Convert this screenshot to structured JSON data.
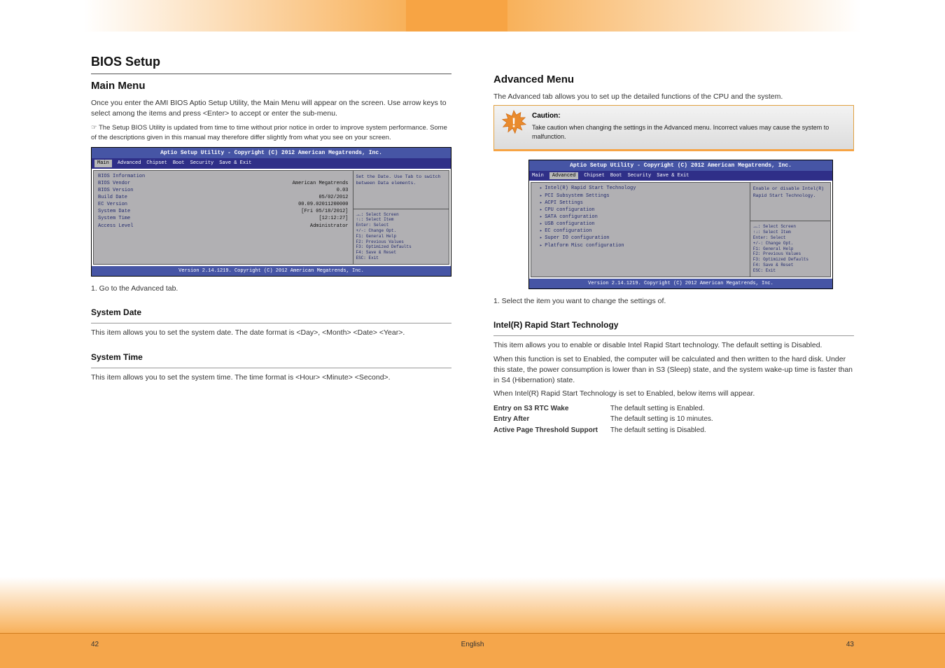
{
  "top_tab": {
    "left": "",
    "center": "",
    "right": ""
  },
  "left_col": {
    "main_heading": "BIOS Setup",
    "section_heading": "Main Menu",
    "intro1": "Once you enter the AMI BIOS Aptio Setup Utility, the Main Menu will appear on the screen. Use arrow keys to select among the items and press <Enter> to accept or enter the sub-menu.",
    "note1": "☞ The Setup BIOS Utility is updated from time to time without prior notice in order to improve system performance. Some of the descriptions given in this manual may therefore differ slightly from what you see on your screen.",
    "bios1": {
      "title": "Aptio Setup Utility - Copyright (C) 2012 American Megatrends, Inc.",
      "tabs": [
        "Main",
        "Advanced",
        "Chipset",
        "Boot",
        "Security",
        "Save & Exit"
      ],
      "active_tab": 0,
      "rows": [
        [
          "BIOS Information",
          ""
        ],
        [
          "BIOS Vendor",
          "American Megatrends"
        ],
        [
          "BIOS Version",
          "0.03"
        ],
        [
          "Build Date",
          "05/02/2012"
        ],
        [
          "",
          ""
        ],
        [
          "EC Version",
          "00.09.02011200000"
        ],
        [
          "",
          ""
        ],
        [
          "System Date",
          "[Fri 05/18/2012]"
        ],
        [
          "System Time",
          "[12:12:27]"
        ],
        [
          "",
          ""
        ],
        [
          "Access Level",
          "Administrator"
        ]
      ],
      "help": "Set the Date. Use Tab to switch between Data elements.",
      "nav": [
        "→←: Select Screen",
        "↑↓: Select Item",
        "Enter: Select",
        "+/-: Change Opt.",
        "F1: General Help",
        "F2: Previous Values",
        "F3: Optimized Defaults",
        "F4: Save & Reset",
        "ESC: Exit"
      ],
      "footer": "Version 2.14.1219. Copyright (C) 2012 American Megatrends, Inc."
    },
    "step1": "1. Go to the Advanced tab.",
    "p_sysdate_h": "System Date",
    "p_sysdate": "This item allows you to set the system date. The date format is <Day>, <Month> <Date> <Year>.",
    "p_systime_h": "System Time",
    "p_systime": "This item allows you to set the system time. The time format is <Hour> <Minute> <Second>."
  },
  "right_col": {
    "main_heading": "Advanced Menu",
    "intro": "The Advanced tab allows you to set up the detailed functions of the CPU and the system.",
    "caution_title": "Caution:",
    "caution_body": "Take caution when changing the settings in the Advanced menu. Incorrect values may cause the system to malfunction.",
    "bios2": {
      "title": "Aptio Setup Utility - Copyright (C) 2012 American Megatrends, Inc.",
      "tabs": [
        "Main",
        "Advanced",
        "Chipset",
        "Boot",
        "Security",
        "Save & Exit"
      ],
      "active_tab": 1,
      "subs": [
        "Intel(R) Rapid Start Technology",
        "PCI Subsystem Settings",
        "ACPI Settings",
        "CPU configuration",
        "SATA configuration",
        "USB configuration",
        "EC configuration",
        "Super IO configuration",
        "Platform Misc configuration"
      ],
      "help": "Enable or disable Intel(R) Rapid Start Technology.",
      "nav": [
        "→←: Select Screen",
        "↑↓: Select Item",
        "Enter: Select",
        "+/-: Change Opt.",
        "F1: General Help",
        "F2: Previous Values",
        "F3: Optimized Defaults",
        "F4: Save & Reset",
        "ESC: Exit"
      ],
      "footer": "Version 2.14.1219. Copyright (C) 2012 American Megatrends, Inc."
    },
    "step2": "1. Select the item you want to change the settings of.",
    "irst_h": "Intel(R) Rapid Start Technology",
    "irst_d1": "This item allows you to enable or disable Intel Rapid Start technology. The default setting is Disabled.",
    "irst_d2": "When this function is set to Enabled, the computer will be calculated and then written to the hard disk. Under this state, the power consumption is lower than in S3 (Sleep) state, and the system wake-up time is faster than in S4 (Hibernation) state.",
    "irst_d3": "When Intel(R) Rapid Start Technology is set to Enabled, below items will appear.",
    "defaults": [
      [
        "Entry on S3 RTC Wake",
        "The default setting is Enabled."
      ],
      [
        "Entry After",
        "The default setting is 10 minutes."
      ],
      [
        "Active Page Threshold Support",
        "The default setting is Disabled."
      ]
    ]
  },
  "footer": {
    "left": "42",
    "center": "English",
    "right": "43"
  }
}
